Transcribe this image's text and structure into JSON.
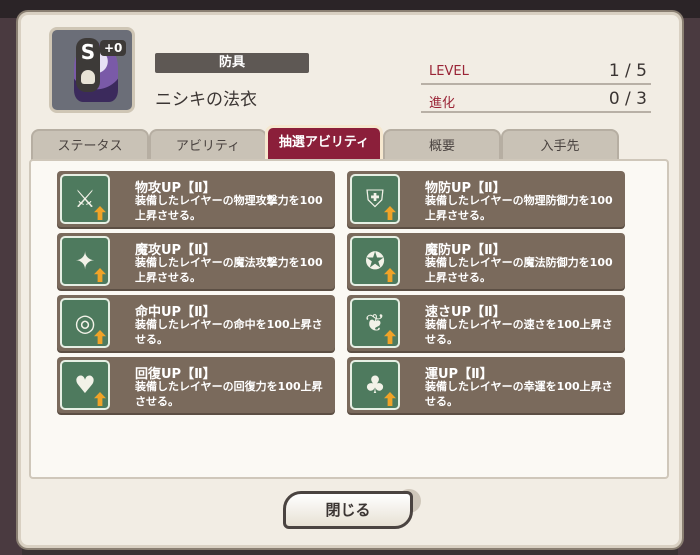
{
  "item": {
    "rank": "S",
    "plus": "+0",
    "category": "防具",
    "name": "ニシキの法衣",
    "level_label": "LEVEL",
    "level_value": "1 / 5",
    "evolution_label": "進化",
    "evolution_value": "0 / 3"
  },
  "tabs": [
    {
      "label": "ステータス",
      "active": false
    },
    {
      "label": "アビリティ",
      "active": false
    },
    {
      "label": "抽選アビリティ",
      "active": true
    },
    {
      "label": "概要",
      "active": false
    },
    {
      "label": "入手先",
      "active": false
    }
  ],
  "abilities": [
    {
      "name": "物攻UP【Ⅱ】",
      "desc": "装備したレイヤーの物理攻撃力を100上昇させる。",
      "icon": "sword-up-icon",
      "glyph": "⚔"
    },
    {
      "name": "物防UP【Ⅱ】",
      "desc": "装備したレイヤーの物理防御力を100上昇させる。",
      "icon": "shield-sword-up-icon",
      "glyph": "⛨"
    },
    {
      "name": "魔攻UP【Ⅱ】",
      "desc": "装備したレイヤーの魔法攻撃力を100上昇させる。",
      "icon": "magic-staff-up-icon",
      "glyph": "✦"
    },
    {
      "name": "魔防UP【Ⅱ】",
      "desc": "装備したレイヤーの魔法防御力を100上昇させる。",
      "icon": "magic-shield-up-icon",
      "glyph": "✪"
    },
    {
      "name": "命中UP【Ⅱ】",
      "desc": "装備したレイヤーの命中を100上昇させる。",
      "icon": "target-up-icon",
      "glyph": "◎"
    },
    {
      "name": "速さUP【Ⅱ】",
      "desc": "装備したレイヤーの速さを100上昇させる。",
      "icon": "wing-up-icon",
      "glyph": "❦"
    },
    {
      "name": "回復UP【Ⅱ】",
      "desc": "装備したレイヤーの回復力を100上昇させる。",
      "icon": "heart-cross-up-icon",
      "glyph": "♥"
    },
    {
      "name": "運UP【Ⅱ】",
      "desc": "装備したレイヤーの幸運を100上昇させる。",
      "icon": "clover-up-icon",
      "glyph": "♣"
    }
  ],
  "close_label": "閉じる"
}
